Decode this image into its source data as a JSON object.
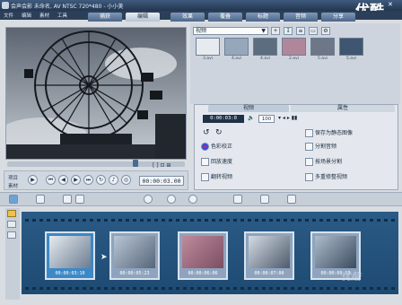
{
  "window": {
    "title": "会声会影 未命名, AV NTSC 720*480 - 小小美"
  },
  "menu": [
    "文件",
    "编辑",
    "素材",
    "工具"
  ],
  "steps": [
    {
      "label": "捕获",
      "active": false
    },
    {
      "label": "编辑",
      "active": true
    },
    {
      "label": "效果",
      "active": false
    },
    {
      "label": "覆叠",
      "active": false
    },
    {
      "label": "标题",
      "active": false
    },
    {
      "label": "音频",
      "active": false
    },
    {
      "label": "分享",
      "active": false
    }
  ],
  "branding": "优酷",
  "preview": {
    "timecode": "00:00:03.00",
    "left_label": "项目",
    "left_label2": "素材"
  },
  "library": {
    "dropdown": "视频",
    "thumbs": [
      "3.avi",
      "4.avi",
      "4.avi",
      "2.avi",
      "5.avi",
      "5.avi"
    ]
  },
  "options": {
    "tab_video": "视频",
    "tab_attr": "属性",
    "duration": "0:00:03:0",
    "volume": "100",
    "items_left": [
      "色彩校正",
      "回放速度",
      "翻转视频"
    ],
    "items_right": [
      "保存为静态图像",
      "分割音频",
      "按场景分割",
      "多重修整视频"
    ]
  },
  "storyboard": {
    "clips": [
      {
        "tc": "00:00:03:10",
        "selected": true
      },
      {
        "tc": "00:00:05:23",
        "selected": false
      },
      {
        "tc": "00:00:06:06",
        "selected": false
      },
      {
        "tc": "00:00:07:00",
        "selected": false
      },
      {
        "tc": "00:00:09:13",
        "selected": false
      }
    ]
  },
  "watermark": "优酷"
}
